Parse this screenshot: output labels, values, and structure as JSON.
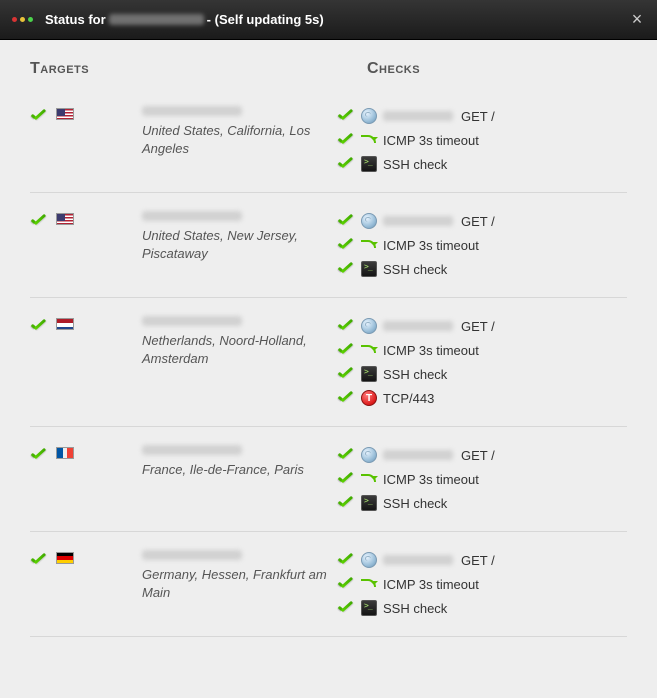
{
  "header": {
    "title_prefix": "Status for",
    "title_suffix": " - (Self updating 5s)",
    "dots": [
      "#d83434",
      "#e8c23a",
      "#4bd34b"
    ]
  },
  "headings": {
    "targets": "Targets",
    "checks": "Checks"
  },
  "check_labels": {
    "get": "GET /",
    "icmp": "ICMP 3s timeout",
    "ssh": "SSH check",
    "tcp": "TCP/443"
  },
  "rows": [
    {
      "flag": "us",
      "location": "United States, California, Los Angeles",
      "checks": [
        "get",
        "icmp",
        "ssh"
      ]
    },
    {
      "flag": "us",
      "location": "United States, New Jersey, Piscataway",
      "checks": [
        "get",
        "icmp",
        "ssh"
      ]
    },
    {
      "flag": "nl",
      "location": "Netherlands, Noord-Holland, Amsterdam",
      "checks": [
        "get",
        "icmp",
        "ssh",
        "tcp"
      ]
    },
    {
      "flag": "fr",
      "location": "France, Ile-de-France, Paris",
      "checks": [
        "get",
        "icmp",
        "ssh"
      ]
    },
    {
      "flag": "de",
      "location": "Germany, Hessen, Frankfurt am Main",
      "checks": [
        "get",
        "icmp",
        "ssh"
      ]
    }
  ]
}
